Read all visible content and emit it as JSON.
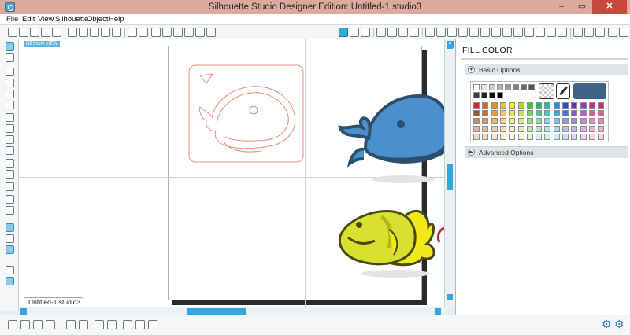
{
  "window": {
    "title": "Silhouette Studio Designer Edition: Untitled-1.studio3",
    "min_glyph": "–",
    "max_glyph": "▭",
    "close_glyph": "✕"
  },
  "menu": {
    "items": [
      "File",
      "Edit",
      "View",
      "Silhouette",
      "Object",
      "Help"
    ]
  },
  "canvas": {
    "view_label": "DESIGN VIEW"
  },
  "document": {
    "tab_label": "Untitled-1.studio3"
  },
  "panel": {
    "title": "FILL COLOR",
    "collapse_glyph": "»",
    "sections": [
      {
        "label": "Basic Options",
        "chevron": "▼"
      },
      {
        "label": "Advanced Options",
        "chevron": "▶"
      }
    ],
    "selected_color": "#3d6386"
  },
  "palette": {
    "grays": [
      "#ffffff",
      "#e4e4e4",
      "#cccccc",
      "#b4b4b4",
      "#9c9c9c",
      "#848484",
      "#6c6c6c",
      "#545454",
      "#3c3c3c",
      "#242424",
      "#111111",
      "#000000"
    ],
    "rows": [
      [
        "#e21b2b",
        "#e85a20",
        "#f09020",
        "#f5c020",
        "#f7ea20",
        "#b4d820",
        "#4ec22a",
        "#22b86a",
        "#20b8b0",
        "#2090d8",
        "#2050c8",
        "#5a30c0",
        "#a030c0",
        "#d02890",
        "#e82060"
      ],
      [
        "#9a5a34",
        "#c46a2a",
        "#e89a3a",
        "#f2c45a",
        "#f4e45a",
        "#c6e05a",
        "#7ad05a",
        "#4ac88a",
        "#4ac8c4",
        "#4aa4e0",
        "#4a74d4",
        "#7a5acc",
        "#b45acc",
        "#dc5aa4",
        "#ec5a84"
      ],
      [
        "#c08a6a",
        "#d89a6a",
        "#f0b47a",
        "#f6d48a",
        "#f8ec8a",
        "#d6e88a",
        "#a4dc8a",
        "#84d8aa",
        "#84d8d6",
        "#84bce8",
        "#849ce0",
        "#a08ad8",
        "#c88ad8",
        "#e68ac0",
        "#f28aa4"
      ],
      [
        "#e6b49a",
        "#eabc9a",
        "#f6cca4",
        "#f8e0b0",
        "#faf2b4",
        "#e4f0b4",
        "#c4e8b4",
        "#b0e6c8",
        "#b0e6e4",
        "#b0d4f0",
        "#b0c0ec",
        "#c4b4e8",
        "#dcb4e8",
        "#f0b4d6",
        "#f6b4c4"
      ],
      [
        "#f4d4c4",
        "#f4d8c4",
        "#fae0cc",
        "#fcecd4",
        "#fcf8d8",
        "#f0f8d8",
        "#e0f4d8",
        "#d4f2e2",
        "#d4f2f0",
        "#d4e6f8",
        "#d4dcf4",
        "#e0d4f4",
        "#ecd4f4",
        "#f8d4e8",
        "#fad4dc"
      ]
    ]
  },
  "icons": {
    "toolbar_left": [
      "new-icon",
      "open-icon",
      "save-icon",
      "print-icon",
      "print-cut-icon",
      "copy-icon",
      "paste-icon",
      "cut-icon",
      "undo-icon",
      "redo-icon",
      "pan-icon",
      "zoom-in-icon",
      "zoom-out-icon",
      "zoom-drag-icon",
      "zoom-fit-icon",
      "page-fit-icon"
    ],
    "toolbar_right": [
      "page-setup-icon",
      "cut-settings-icon",
      "send-icon",
      "fill-color-icon",
      "line-color-icon",
      "line-style-icon",
      "fill-pattern-icon",
      "gradient-icon",
      "transform-icon",
      "replicate-icon",
      "offset-icon",
      "trace-icon",
      "modify-icon",
      "align-icon",
      "layer-icon",
      "library-icon",
      "store-icon"
    ],
    "left_tools": [
      "select-icon",
      "point-edit-icon",
      "line-icon",
      "rectangle-icon",
      "rounded-rect-icon",
      "ellipse-icon",
      "polygon-icon",
      "curve-icon",
      "freehand-icon",
      "smooth-freehand-icon",
      "arc-icon",
      "regular-polygon-icon",
      "text-icon",
      "eraser-icon",
      "knife-icon",
      "show-cut-icon",
      "page-icon",
      "library-toggle-icon",
      "store-toggle-icon",
      "settings-icon"
    ],
    "bottom": [
      "group-icon",
      "ungroup-icon",
      "compound-icon",
      "release-compound-icon",
      "duplicate-icon",
      "delete-icon",
      "mirror-icon",
      "weld-icon",
      "rotate-icon",
      "bring-front-icon",
      "send-back-icon"
    ]
  }
}
